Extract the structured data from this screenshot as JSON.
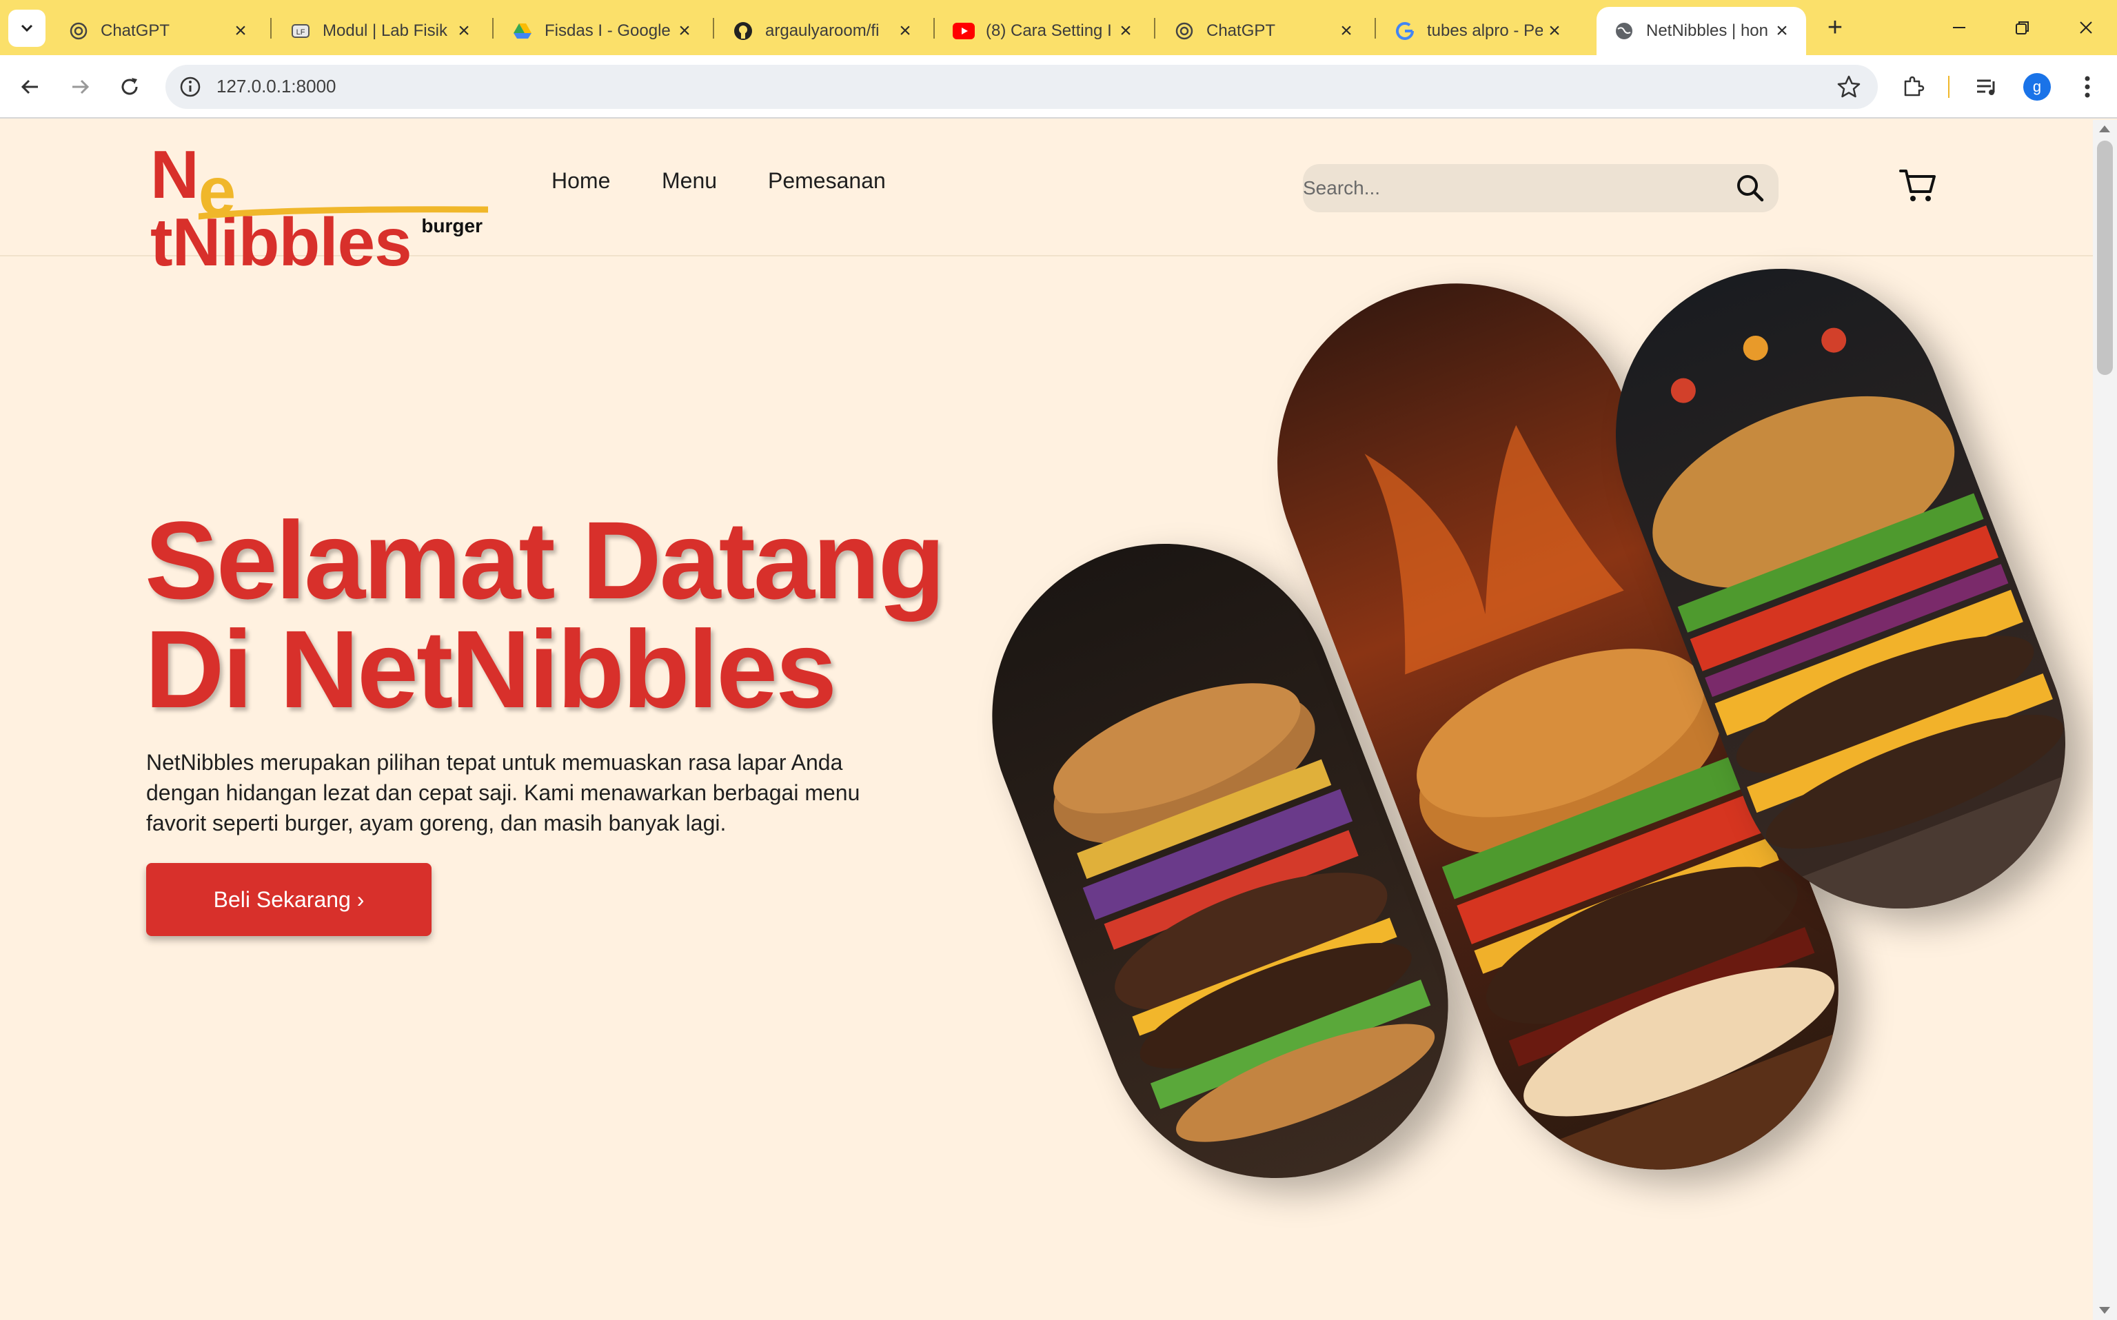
{
  "browser": {
    "tabs": [
      {
        "title": "ChatGPT",
        "icon": "chatgpt-icon",
        "active": false
      },
      {
        "title": "Modul | Lab Fisik",
        "icon": "lab-icon",
        "active": false
      },
      {
        "title": "Fisdas I - Google",
        "icon": "google-drive-icon",
        "active": false
      },
      {
        "title": "argaulyaroom/fi",
        "icon": "github-icon",
        "active": false
      },
      {
        "title": "(8) Cara Setting I",
        "icon": "youtube-icon",
        "active": false
      },
      {
        "title": "ChatGPT",
        "icon": "chatgpt-icon",
        "active": false
      },
      {
        "title": "tubes alpro - Pe",
        "icon": "google-icon",
        "active": false
      },
      {
        "title": "NetNibbles | hon",
        "icon": "globe-icon",
        "active": true
      }
    ],
    "url": "127.0.0.1:8000",
    "profile_initial": "g",
    "colors": {
      "tabbar": "#fbe06a",
      "accent": "#1a73e8"
    }
  },
  "site": {
    "logo": {
      "word_start": "N",
      "word_e": "e",
      "word_end": "tNibbles",
      "sub": "burger"
    },
    "nav": [
      {
        "label": "Home"
      },
      {
        "label": "Menu"
      },
      {
        "label": "Pemesanan"
      }
    ],
    "search": {
      "placeholder": "Search..."
    },
    "colors": {
      "brand_red": "#d8302b",
      "brand_yellow": "#f0b72a",
      "background": "#fff1e0"
    }
  },
  "hero": {
    "title_line1": "Selamat Datang",
    "title_line2": "Di NetNibbles",
    "description": "NetNibbles merupakan pilihan tepat untuk memuaskan rasa lapar Anda dengan hidangan lezat dan cepat saji. Kami menawarkan berbagai menu favorit seperti burger, ayam goreng, dan masih banyak lagi.",
    "cta_label": "Beli Sekarang ›"
  }
}
